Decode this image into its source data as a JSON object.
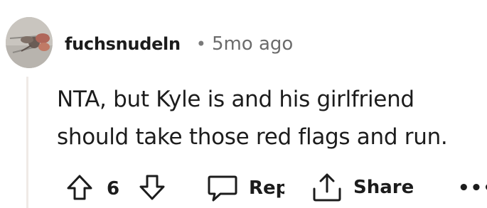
{
  "comment": {
    "author": "fuchsnudeln",
    "separator": "•",
    "time": "5mo ago",
    "body_lines": [
      "NTA, but Kyle is and his girlfriend",
      "should take those red flags and run."
    ]
  },
  "actions": {
    "vote_count": "6",
    "reply_label": "Reply",
    "share_label": "Share",
    "more_label": "•••"
  },
  "icons": {
    "upvote": "upvote-arrow-icon",
    "downvote": "downvote-arrow-icon",
    "reply": "speech-bubble-icon",
    "share": "share-upload-icon",
    "more": "more-dots-icon"
  },
  "colors": {
    "text": "#1c1c1c",
    "meta": "#6b6b6b",
    "thread_line": "#efeae6"
  }
}
